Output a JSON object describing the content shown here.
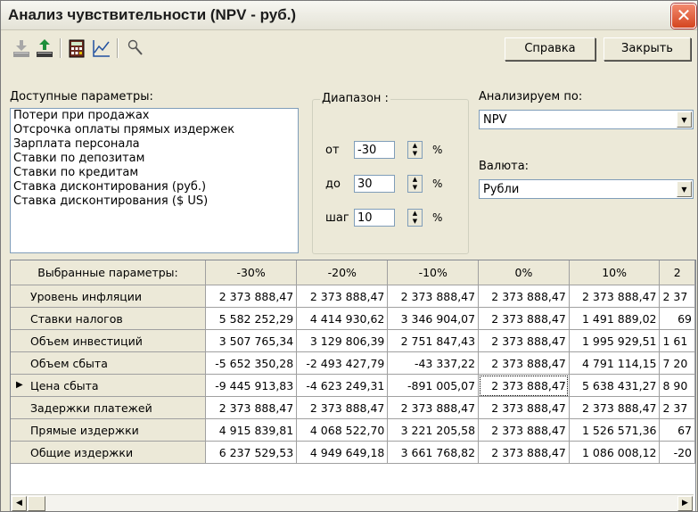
{
  "window": {
    "title": "Анализ чувствительности (NPV - руб.)",
    "close_glyph": "✕"
  },
  "toolbar": {
    "icons": [
      "export-down-icon",
      "export-up-icon",
      "calculator-icon",
      "chart-icon",
      "search-icon"
    ]
  },
  "buttons": {
    "help": "Справка",
    "close": "Закрыть"
  },
  "available": {
    "label": "Доступные параметры:",
    "items": [
      "Потери при продажах",
      "Отсрочка оплаты прямых издержек",
      "Зарплата персонала",
      "Ставки по депозитам",
      "Ставки по кредитам",
      "Ставка дисконтирования (руб.)",
      "Ставка дисконтирования ($ US)"
    ]
  },
  "range": {
    "title": "Диапазон :",
    "from_label": "от",
    "from_value": "-30",
    "to_label": "до",
    "to_value": "30",
    "step_label": "шаг",
    "step_value": "10",
    "unit": "%"
  },
  "analyze": {
    "label": "Анализируем по:",
    "value": "NPV"
  },
  "currency": {
    "label": "Валюта:",
    "value": "Рубли"
  },
  "table": {
    "header": "Выбранные параметры:",
    "columns": [
      "-30%",
      "-20%",
      "-10%",
      "0%",
      "10%",
      "2"
    ],
    "rows": [
      {
        "name": "Уровень инфляции",
        "values": [
          "2 373 888,47",
          "2 373 888,47",
          "2 373 888,47",
          "2 373 888,47",
          "2 373 888,47",
          "2 37"
        ]
      },
      {
        "name": "Ставки налогов",
        "values": [
          "5 582 252,29",
          "4 414 930,62",
          "3 346 904,07",
          "2 373 888,47",
          "1 491 889,02",
          "69"
        ]
      },
      {
        "name": "Объем инвестиций",
        "values": [
          "3 507 765,34",
          "3 129 806,39",
          "2 751 847,43",
          "2 373 888,47",
          "1 995 929,51",
          "1 61"
        ]
      },
      {
        "name": "Объем сбыта",
        "values": [
          "-5 652 350,28",
          "-2 493 427,79",
          "-43 337,22",
          "2 373 888,47",
          "4 791 114,15",
          "7 20"
        ]
      },
      {
        "name": "Цена сбыта",
        "values": [
          "-9 445 913,83",
          "-4 623 249,31",
          "-891 005,07",
          "2 373 888,47",
          "5 638 431,27",
          "8 90"
        ]
      },
      {
        "name": "Задержки платежей",
        "values": [
          "2 373 888,47",
          "2 373 888,47",
          "2 373 888,47",
          "2 373 888,47",
          "2 373 888,47",
          "2 37"
        ]
      },
      {
        "name": "Прямые издержки",
        "values": [
          "4 915 839,81",
          "4 068 522,70",
          "3 221 205,58",
          "2 373 888,47",
          "1 526 571,36",
          "67"
        ]
      },
      {
        "name": "Общие издержки",
        "values": [
          "6 237 529,53",
          "4 949 649,18",
          "3 661 768,82",
          "2 373 888,47",
          "1 086 008,12",
          "-20"
        ]
      }
    ],
    "current_row_marker": "▶"
  },
  "scrollbar": {
    "left": "◀",
    "right": "▶"
  }
}
